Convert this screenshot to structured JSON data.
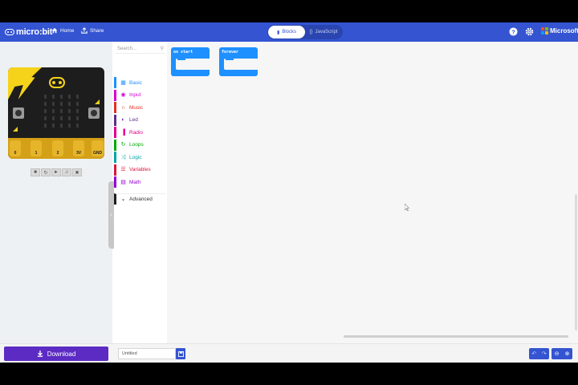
{
  "header": {
    "logo_text": "micro:bit",
    "home_label": "Home",
    "share_label": "Share",
    "blocks_label": "Blocks",
    "javascript_label": "JavaScript",
    "microsoft_label": "Microsoft",
    "colors": {
      "brand": "#3454d1"
    }
  },
  "simulator": {
    "pins": [
      "0",
      "1",
      "2",
      "3V",
      "GND"
    ],
    "tools": [
      "stop",
      "restart",
      "slow-mo",
      "mute",
      "fullscreen"
    ]
  },
  "toolbox": {
    "search_placeholder": "Search...",
    "categories": [
      {
        "label": "Basic",
        "icon": "grid-icon",
        "color": "#1e90ff"
      },
      {
        "label": "Input",
        "icon": "target-icon",
        "color": "#d400d4"
      },
      {
        "label": "Music",
        "icon": "headphones-icon",
        "color": "#e63022"
      },
      {
        "label": "Led",
        "icon": "toggle-icon",
        "color": "#5c2d91"
      },
      {
        "label": "Radio",
        "icon": "signal-icon",
        "color": "#e3008c"
      },
      {
        "label": "Loops",
        "icon": "refresh-icon",
        "color": "#00aa00"
      },
      {
        "label": "Logic",
        "icon": "shuffle-icon",
        "color": "#00a4a6"
      },
      {
        "label": "Variables",
        "icon": "list-icon",
        "color": "#dc143c"
      },
      {
        "label": "Math",
        "icon": "calculator-icon",
        "color": "#9400d3"
      },
      {
        "label": "Advanced",
        "icon": "chevron-down-icon",
        "color": "#1e1e1e"
      }
    ]
  },
  "workspace": {
    "blocks": [
      {
        "label": "on start"
      },
      {
        "label": "forever"
      }
    ]
  },
  "footer": {
    "download_label": "Download",
    "project_name": "Untitled"
  }
}
